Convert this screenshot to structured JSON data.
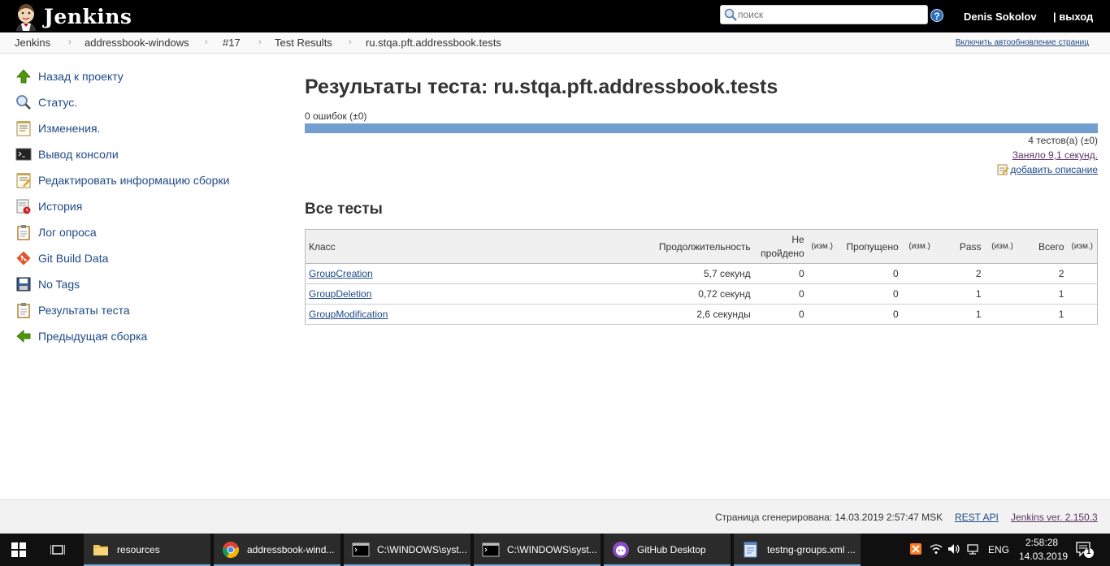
{
  "header": {
    "logo_text": "Jenkins",
    "search_placeholder": "поиск",
    "help_label": "?",
    "user_name": "Denis Sokolov",
    "logout_label": "| выход"
  },
  "breadcrumbs": {
    "items": [
      "Jenkins",
      "addressbook-windows",
      "#17",
      "Test Results",
      "ru.stqa.pft.addressbook.tests"
    ],
    "separator": "›",
    "auto_refresh": "Включить автообновление страниц"
  },
  "side_panel": {
    "items": [
      {
        "label": "Назад к проекту",
        "icon": "up-arrow-icon"
      },
      {
        "label": "Статус.",
        "icon": "magnifier-icon"
      },
      {
        "label": "Изменения.",
        "icon": "notepad-icon"
      },
      {
        "label": "Вывод консоли",
        "icon": "terminal-icon"
      },
      {
        "label": "Редактировать информацию сборки",
        "icon": "notepad-edit-icon"
      },
      {
        "label": "История",
        "icon": "history-icon"
      },
      {
        "label": "Лог опроса",
        "icon": "clipboard-icon"
      },
      {
        "label": "Git Build Data",
        "icon": "git-icon"
      },
      {
        "label": "No Tags",
        "icon": "save-icon"
      },
      {
        "label": "Результаты теста",
        "icon": "clipboard-icon"
      },
      {
        "label": "Предыдущая сборка",
        "icon": "left-arrow-icon"
      }
    ]
  },
  "main": {
    "title": "Результаты теста: ru.stqa.pft.addressbook.tests",
    "fail_count": "0 ошибок (±0)",
    "test_count": "4 тестов(а) (±0)",
    "duration": "Заняло 9,1 секунд.",
    "add_description": "добавить описание",
    "all_tests_title": "Все тесты",
    "progress_pass_fraction": 1.0
  },
  "table": {
    "headers": {
      "class": "Класс",
      "duration": "Продолжительность",
      "failed_line1": "Не",
      "failed_line2": "пройдено",
      "diff": "(изм.)",
      "skipped": "Пропущено",
      "pass": "Pass",
      "total": "Всего"
    },
    "rows": [
      {
        "class": "GroupCreation",
        "duration": "5,7 секунд",
        "failed": "0",
        "skipped": "0",
        "pass": "2",
        "total": "2"
      },
      {
        "class": "GroupDeletion",
        "duration": "0,72 секунд",
        "failed": "0",
        "skipped": "0",
        "pass": "1",
        "total": "1"
      },
      {
        "class": "GroupModification",
        "duration": "2,6 секунды",
        "failed": "0",
        "skipped": "0",
        "pass": "1",
        "total": "1"
      }
    ]
  },
  "footer": {
    "generated": "Страница сгенерирована: 14.03.2019 2:57:47 MSK",
    "rest_api": "REST API",
    "version": "Jenkins ver. 2.150.3"
  },
  "taskbar": {
    "apps": [
      {
        "label": "resources",
        "icon": "folder-icon"
      },
      {
        "label": "addressbook-wind...",
        "icon": "chrome-icon"
      },
      {
        "label": "C:\\WINDOWS\\syst...",
        "icon": "cmd-icon"
      },
      {
        "label": "C:\\WINDOWS\\syst...",
        "icon": "cmd-icon"
      },
      {
        "label": "GitHub Desktop",
        "icon": "github-icon"
      },
      {
        "label": "testng-groups.xml ...",
        "icon": "notepad-icon"
      }
    ],
    "language": "ENG",
    "time": "2:58:28",
    "date": "14.03.2019",
    "notification_count": "1"
  }
}
